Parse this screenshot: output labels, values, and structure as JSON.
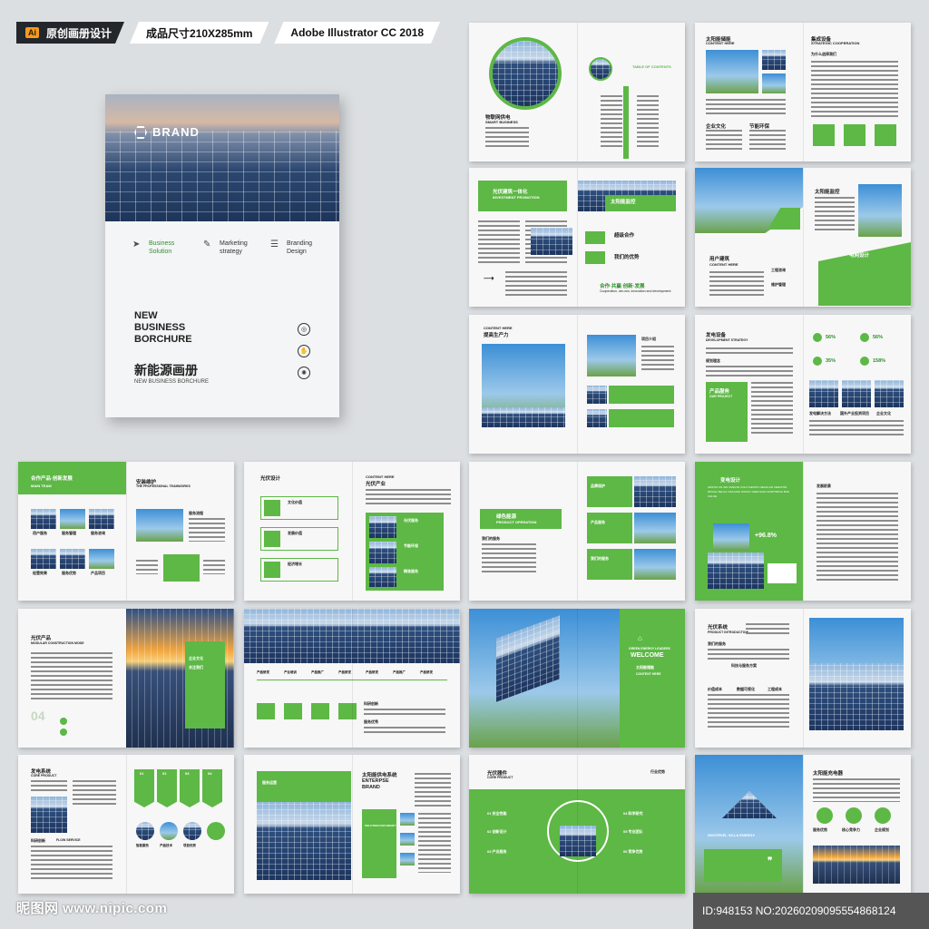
{
  "header": {
    "app_icon": "Ai",
    "tag1": "原创画册设计",
    "tag2": "成品尺寸210X285mm",
    "tag3": "Adobe Illustrator CC 2018"
  },
  "cover": {
    "brand": "BRAND",
    "features": [
      {
        "icon": "paper-plane-icon",
        "l1": "Business",
        "l2": "Solution"
      },
      {
        "icon": "pen-icon",
        "l1": "Marketing",
        "l2": "strategy"
      },
      {
        "icon": "layers-icon",
        "l1": "Branding",
        "l2": "Design"
      }
    ],
    "title_l1": "NEW",
    "title_l2": "BUSINESS",
    "title_l3": "BORCHURE",
    "title_cn": "新能源画册",
    "subtitle": "NEW BUSINESS BORCHURE"
  },
  "spreads": {
    "s1": {
      "title_cn": "物联网供电",
      "title_en": "SMART BUSINESS",
      "toc": "TABLE OF CONTENTS"
    },
    "s2": {
      "t1": "太阳能储能",
      "t1_en": "CONTENT HERE",
      "t2": "集成设备",
      "t2_en": "STRATEGIC COOPERATION",
      "t3": "为什么选择我们",
      "c1": "企业文化",
      "c2": "节能环保"
    },
    "s3": {
      "t1": "光伏建筑一体化",
      "t1_en": "INVESTMENT PROMOTION",
      "t2": "太阳能监控",
      "t2_en": "OUR STRENGTHS",
      "t3": "超级合作",
      "t4": "我们的优势",
      "t5": "合作·共赢·创新·发展",
      "t5_en": "Cooperation, win-win, innovation and development"
    },
    "s4": {
      "t1": "太阳能监控",
      "t2": "用户建筑",
      "t2_en": "CONTENT HERE",
      "t3": "工程咨询",
      "t4": "维护管理",
      "t5": "专业解决",
      "t6": "电网设计"
    },
    "s5": {
      "t1": "CONTENT HERE",
      "t2": "提高生产力",
      "t3": "项目介绍"
    },
    "s6": {
      "t1": "发电设备",
      "t1_en": "DEVELOPMENT STRATEGY",
      "t2": "规划理念",
      "t3": "产品服务",
      "t3_en": "OUR PROJECT",
      "p1": "56%",
      "p2": "56%",
      "p3": "35%",
      "p4": "158%",
      "c1": "发电解决方法",
      "c2": "国外产业投资项目",
      "c3": "企业文化"
    },
    "s7": {
      "t1": "合作产品·创新发展",
      "t1_en": "MAIN TEAM",
      "t2": "安装维护",
      "t2_en": "THE PROFESSIONAL TEAMWORKS",
      "t3": "服务流程",
      "c1": "用户服务",
      "c2": "服务管理",
      "c3": "服务咨询",
      "c4": "经营效果",
      "c5": "服务优势",
      "c6": "产品项目"
    },
    "s8": {
      "t1": "光伏设计",
      "t2": "CONTENT HERE",
      "t3": "光伏产业",
      "r1": "文化价值",
      "r2": "发展价值",
      "r3": "经济增长",
      "b1": "光伏服务",
      "b2": "节能环保",
      "b3": "精准服务"
    },
    "s9": {
      "t1": "绿色能源",
      "t1_en": "PRODUCT OPERATION",
      "t2": "我们的服务",
      "r1": "品牌保护",
      "r2": "产品服务",
      "r3": "我们的服务"
    },
    "s10": {
      "t1": "变电设计",
      "t2": "+96.8%",
      "t3": "发展前景",
      "intro": "ADSTAT AN IGN VANGTE VOLO GENITO NEGULAR CERATOR DIVUAL SEUCL OSA GRO WIOAO THEN DAIN AFOPTMIOG BUN UALOE"
    },
    "s11": {
      "t1": "光伏产品",
      "t1_en": "MODULAR CONSTRUCTION MODE",
      "num": "04",
      "t2": "企业文化",
      "t3": "关注我们"
    },
    "s12": {
      "years": [
        "产品研发",
        "产业培训",
        "产品推广",
        "产品研发",
        "产品研发",
        "产品推广",
        "产品研发"
      ],
      "t1": "科研创新",
      "t2": "服务优秀"
    },
    "s13": {
      "t1": "GREEN ENERGY LEADERS",
      "t2": "WELCOME",
      "t3": "太阳能储能",
      "t4": "CONTENT HERE"
    },
    "s14": {
      "t1": "光伏系统",
      "t1_en": "PRODUCT INTRODUCTION",
      "t2": "我们的服务",
      "t3": "科技与服务方案",
      "c1": "价值成本",
      "c2": "数据可视化",
      "c3": "工程成本"
    },
    "s15": {
      "t1": "发电系统",
      "t1_en": "CORE PRODUCT",
      "steps": [
        "01",
        "02",
        "03",
        "04"
      ],
      "c1": "科研创新",
      "c2": "FLOW SERVICE",
      "c3": "智能服务",
      "c4": "产品技术",
      "c5": "项目优势"
    },
    "s16": {
      "t1": "服务运营",
      "t2": "太阳能供电系统",
      "t3": "ENTERPSE",
      "t4": "BRAND",
      "t5": "SOLUTION FOR SMART BUSINESS"
    },
    "s17": {
      "t1": "光伏器件",
      "t1_en": "CORE PRODUCT",
      "t2": "行业优势",
      "l1": "01 安全性能",
      "l2": "02 创新设计",
      "l3": "03 产业服务",
      "r1": "04 科学研究",
      "r2": "05 专业团队",
      "r3": "06 竞争优势"
    },
    "s18": {
      "t1": "太阳能充电器",
      "t2": "SHOTRVEL VILLA ENERGY",
      "c1": "服务优势",
      "c2": "核心竞争力",
      "c3": "企业规划"
    }
  },
  "footer": {
    "watermark": "昵图网 www.nipic.com",
    "id": "ID:948153 NO:20260209095554868124"
  },
  "colors": {
    "accent": "#5db845",
    "dark": "#23262b"
  }
}
